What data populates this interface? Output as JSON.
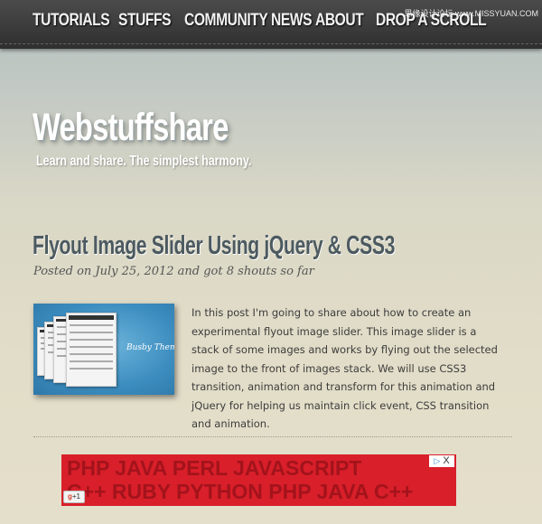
{
  "nav": {
    "items": [
      {
        "label": "TUTORIALS"
      },
      {
        "label": "STUFFS"
      },
      {
        "label": "COMMUNITY NEWS"
      },
      {
        "label": "ABOUT"
      },
      {
        "label": "DROP A SCROLL"
      }
    ],
    "watermark": "思缘设计论坛 www.MISSYUAN.COM"
  },
  "site": {
    "title": "Webstuffshare",
    "tagline": "Learn and share. The simplest harmony."
  },
  "post": {
    "title": "Flyout Image Slider Using jQuery & CSS3",
    "meta": "Posted on July 25, 2012 and got 8 shouts so far",
    "thumbnail_caption": "Busby Theme",
    "excerpt": "In this post I'm going to share about how to create an experimental flyout image slider. This image slider is a stack of some images and works by flying out the selected image to the front of images stack. We will use CSS3 transition, animation and transform for this animation and jQuery for helping us maintain click event, CSS transition and animation."
  },
  "ad": {
    "line1": "PHP JAVA PERL JAVASCRIPT",
    "line2": "C++ RUBY PYTHON PHP JAVA C++",
    "plusone": "+1",
    "close": "X"
  },
  "colors": {
    "nav_bg": "#3a3a3a",
    "title_color": "#4c5a60",
    "ad_red": "#d81f2a",
    "thumb_blue": "#3b8cbf"
  }
}
